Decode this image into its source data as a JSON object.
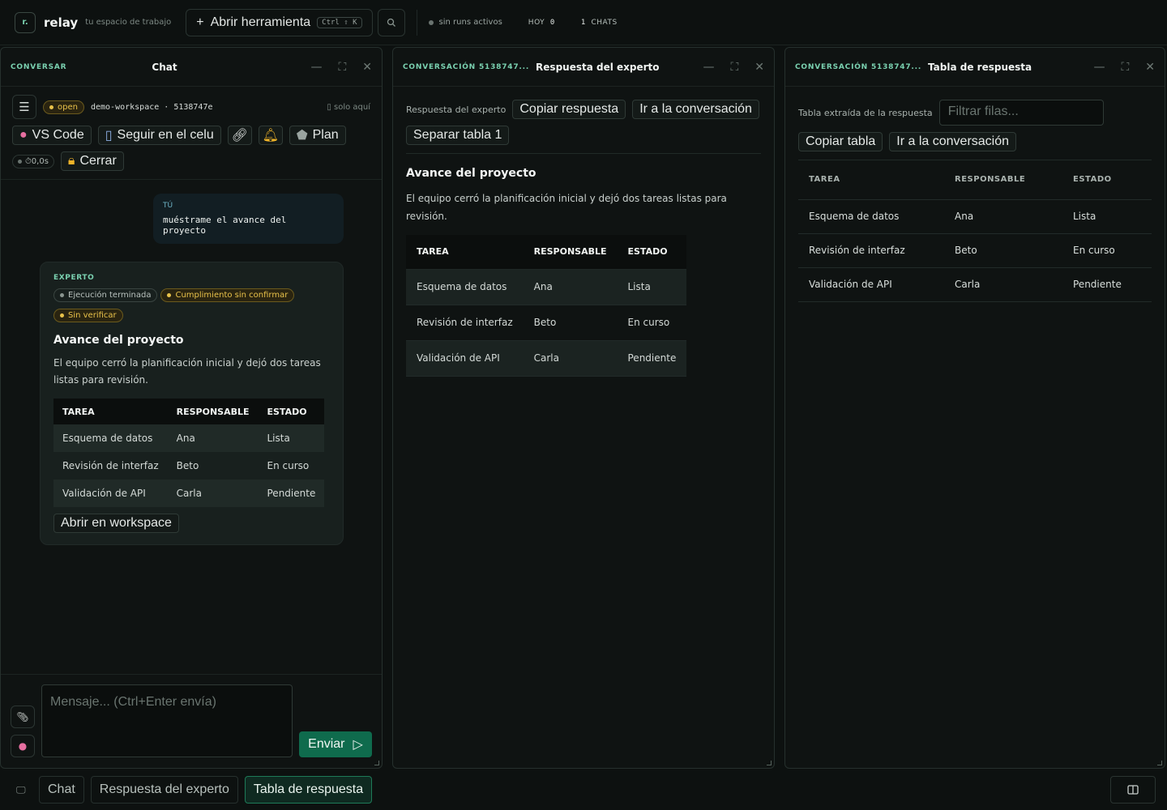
{
  "topbar": {
    "logo": "r.",
    "brand": "relay",
    "tagline": "tu espacio de trabajo",
    "open_tool": "Abrir herramienta",
    "shortcut": "Ctrl ⇧ K",
    "runs": "sin runs activos",
    "today_label": "HOY",
    "today_count": "0",
    "chats_count": "1",
    "chats_label": "CHATS"
  },
  "chat_panel": {
    "kicker": "CONVERSAR",
    "title": "Chat",
    "status": "open",
    "workspace": "demo-workspace · 5138747e",
    "scope": "▯ solo aquí",
    "actions": [
      "VS Code",
      "Seguir en el celu",
      "Plan"
    ],
    "timer": "⏱0,0s",
    "close": "Cerrar",
    "user_label": "TÚ",
    "user_message": "muéstrame el avance del proyecto",
    "expert_label": "EXPERTO",
    "chips": [
      "Ejecución terminada",
      "Cumplimiento sin confirmar",
      "Sin verificar"
    ],
    "expert_title": "Avance del proyecto",
    "expert_text": "El equipo cerró la planificación inicial y dejó dos tareas listas para revisión.",
    "open_workspace": "Abrir en workspace",
    "placeholder": "Mensaje... (Ctrl+Enter envía)",
    "send": "Enviar"
  },
  "table": {
    "headers": [
      "TAREA",
      "RESPONSABLE",
      "ESTADO"
    ],
    "rows": [
      [
        "Esquema de datos",
        "Ana",
        "Lista"
      ],
      [
        "Revisión de interfaz",
        "Beto",
        "En curso"
      ],
      [
        "Validación de API",
        "Carla",
        "Pendiente"
      ]
    ]
  },
  "expert_panel": {
    "kicker": "CONVERSACIÓN 5138747...",
    "title": "Respuesta del experto",
    "label": "Respuesta del experto",
    "copy": "Copiar respuesta",
    "goto": "Ir a la conversación",
    "split": "Separar tabla 1",
    "heading": "Avance del proyecto",
    "text": "El equipo cerró la planificación inicial y dejó dos tareas listas para revisión."
  },
  "table_panel": {
    "kicker": "CONVERSACIÓN 5138747...",
    "title": "Tabla de respuesta",
    "label": "Tabla extraída de la respuesta",
    "filter_placeholder": "Filtrar filas...",
    "copy": "Copiar tabla",
    "goto": "Ir a la conversación"
  },
  "taskbar": {
    "items": [
      "Chat",
      "Respuesta del experto",
      "Tabla de respuesta"
    ],
    "active": "Tabla de respuesta"
  },
  "colors": {
    "accent": "#7ad1b0",
    "warn": "#e9c24a",
    "send": "#0f6b4d"
  }
}
